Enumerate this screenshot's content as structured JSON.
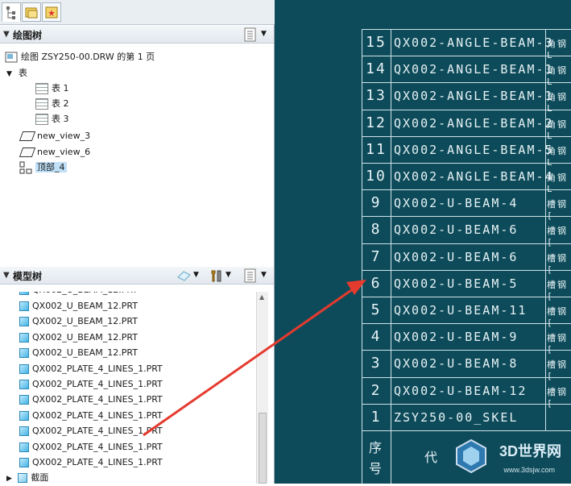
{
  "drawing_tree": {
    "title": "绘图树",
    "root": "绘图 ZSY250-00.DRW 的第 1 页",
    "tables_group": "表",
    "tables": [
      "表 1",
      "表 2",
      "表 3"
    ],
    "views": [
      "new_view_3",
      "new_view_6"
    ],
    "selected": "顶部_4"
  },
  "model_tree": {
    "title": "模型树",
    "items": [
      "QX002_U_BEAM_12.PRT",
      "QX002_U_BEAM_12.PRT",
      "QX002_U_BEAM_12.PRT",
      "QX002_U_BEAM_12.PRT",
      "QX002_PLATE_4_LINES_1.PRT",
      "QX002_PLATE_4_LINES_1.PRT",
      "QX002_PLATE_4_LINES_1.PRT",
      "QX002_PLATE_4_LINES_1.PRT",
      "QX002_PLATE_4_LINES_1.PRT",
      "QX002_PLATE_4_LINES_1.PRT",
      "QX002_PLATE_4_LINES_1.PRT"
    ],
    "section_item": "截面"
  },
  "bom": {
    "rows": [
      {
        "no": "15",
        "code": "QX002-ANGLE-BEAM-3",
        "mat": "角钢L"
      },
      {
        "no": "14",
        "code": "QX002-ANGLE-BEAM-1",
        "mat": "角钢L"
      },
      {
        "no": "13",
        "code": "QX002-ANGLE-BEAM-1",
        "mat": "角钢L"
      },
      {
        "no": "12",
        "code": "QX002-ANGLE-BEAM-2",
        "mat": "角钢L"
      },
      {
        "no": "11",
        "code": "QX002-ANGLE-BEAM-5",
        "mat": "角钢L"
      },
      {
        "no": "10",
        "code": "QX002-ANGLE-BEAM-4",
        "mat": "角钢L"
      },
      {
        "no": "9",
        "code": "QX002-U-BEAM-4",
        "mat": "槽钢["
      },
      {
        "no": "8",
        "code": "QX002-U-BEAM-6",
        "mat": "槽钢["
      },
      {
        "no": "7",
        "code": "QX002-U-BEAM-6",
        "mat": "槽钢["
      },
      {
        "no": "6",
        "code": "QX002-U-BEAM-5",
        "mat": "槽钢["
      },
      {
        "no": "5",
        "code": "QX002-U-BEAM-11",
        "mat": "槽钢["
      },
      {
        "no": "4",
        "code": "QX002-U-BEAM-9",
        "mat": "槽钢["
      },
      {
        "no": "3",
        "code": "QX002-U-BEAM-8",
        "mat": "槽钢["
      },
      {
        "no": "2",
        "code": "QX002-U-BEAM-12",
        "mat": "槽钢["
      },
      {
        "no": "1",
        "code": "ZSY250-00_SKEL",
        "mat": ""
      }
    ],
    "header_no_1": "序",
    "header_no_2": "号",
    "header_code": "代"
  },
  "watermark": {
    "brand": "3D世界网",
    "url": "www.3dsjw.com"
  },
  "colors": {
    "canvas": "#0e4b5a",
    "arrow": "#e53a2e",
    "selection": "#bfe0f7"
  }
}
